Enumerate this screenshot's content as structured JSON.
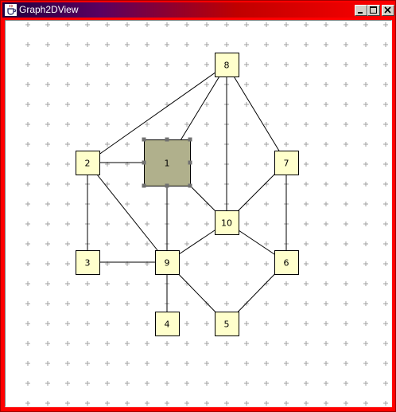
{
  "window": {
    "title": "Graph2DView"
  },
  "colors": {
    "node_fill": "#ffffcc",
    "node_selected_fill": "#b0b08c",
    "edge": "#000000",
    "grid": "#a0a0a0",
    "handle": "#707070"
  },
  "graph": {
    "nodes": [
      {
        "id": "1",
        "label": "1",
        "selected": true
      },
      {
        "id": "2",
        "label": "2",
        "selected": false
      },
      {
        "id": "3",
        "label": "3",
        "selected": false
      },
      {
        "id": "4",
        "label": "4",
        "selected": false
      },
      {
        "id": "5",
        "label": "5",
        "selected": false
      },
      {
        "id": "6",
        "label": "6",
        "selected": false
      },
      {
        "id": "7",
        "label": "7",
        "selected": false
      },
      {
        "id": "8",
        "label": "8",
        "selected": false
      },
      {
        "id": "9",
        "label": "9",
        "selected": false
      },
      {
        "id": "10",
        "label": "10",
        "selected": false
      }
    ],
    "edges": [
      [
        "8",
        "2"
      ],
      [
        "8",
        "1"
      ],
      [
        "8",
        "10"
      ],
      [
        "8",
        "7"
      ],
      [
        "2",
        "1"
      ],
      [
        "2",
        "3"
      ],
      [
        "2",
        "9"
      ],
      [
        "1",
        "9"
      ],
      [
        "1",
        "10"
      ],
      [
        "3",
        "9"
      ],
      [
        "9",
        "4"
      ],
      [
        "9",
        "10"
      ],
      [
        "9",
        "5"
      ],
      [
        "7",
        "10"
      ],
      [
        "7",
        "6"
      ],
      [
        "10",
        "6"
      ],
      [
        "6",
        "5"
      ]
    ]
  }
}
